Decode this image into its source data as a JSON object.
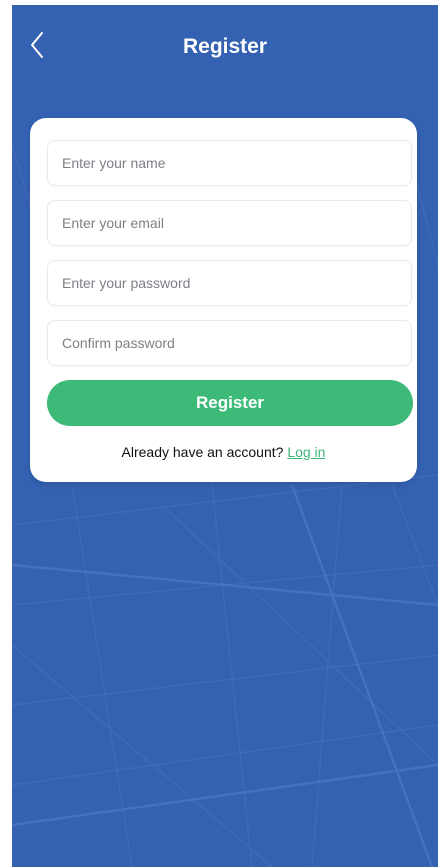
{
  "header": {
    "title": "Register",
    "back_icon": "chevron-left-icon"
  },
  "form": {
    "name_placeholder": "Enter your name",
    "email_placeholder": "Enter your email",
    "password_placeholder": "Enter your password",
    "confirm_placeholder": "Confirm password",
    "register_label": "Register",
    "login_prompt": "Already have an account?",
    "login_link": "Log in"
  },
  "colors": {
    "background": "#3461b1",
    "button": "#3dba77",
    "link": "#3fb67a"
  }
}
